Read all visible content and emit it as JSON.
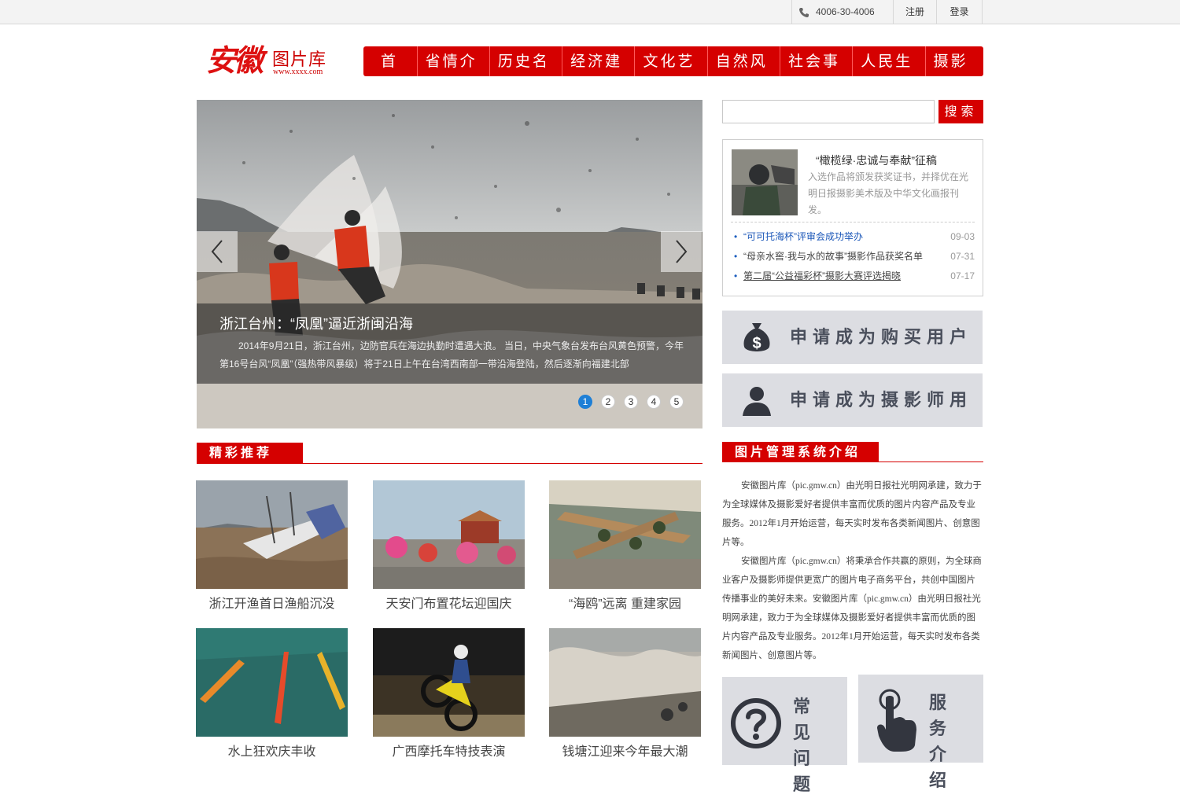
{
  "topbar": {
    "phone": "4006-30-4006",
    "register": "注册",
    "login": "登录"
  },
  "logo": {
    "calligraphy": "安徽",
    "library": "图片库",
    "url": "www.xxxx.com"
  },
  "nav": {
    "items": [
      "首页",
      "省情介绍",
      "历史名人",
      "经济建设",
      "文化艺术",
      "自然风光",
      "社会事业",
      "人民生活",
      "摄影师"
    ]
  },
  "slider": {
    "title": "浙江台州：“凤凰”逼近浙闽沿海",
    "desc": "2014年9月21日，浙江台州，边防官兵在海边执勤时遭遇大浪。 当日，中央气象台发布台风黄色预警，今年第16号台风“凤凰”（强热带风暴级）将于21日上午在台湾西南部一带沿海登陆，然后逐渐向福建北部",
    "dots": [
      "1",
      "2",
      "3",
      "4",
      "5"
    ],
    "active_dot": 1
  },
  "featured": {
    "title": "精彩推荐",
    "items": [
      "浙江开渔首日渔船沉没",
      "天安门布置花坛迎国庆",
      "“海鸥”远离 重建家园",
      "水上狂欢庆丰收",
      "广西摩托车特技表演",
      "钱塘江迎来今年最大潮"
    ]
  },
  "search": {
    "placeholder": "",
    "button": "搜索"
  },
  "news": {
    "headline": "“橄榄绿·忠诚与奉献”征稿",
    "headline_desc": "入选作品将颁发获奖证书，并择优在光明日报摄影美术版及中华文化画报刊发。",
    "items": [
      {
        "title": "“可可托海杯”评审会成功举办",
        "date": "09-03"
      },
      {
        "title": "“母亲水窖·我与水的故事”摄影作品获奖名单",
        "date": "07-31"
      },
      {
        "title": "第二届“公益福彩杯”摄影大赛评选揭晓",
        "date": "07-17"
      }
    ]
  },
  "apply": {
    "buyer": "申请成为购买用户",
    "photographer": "申请成为摄影师用户"
  },
  "intro": {
    "title": "图片管理系统介绍",
    "p1": "安徽图片库（pic.gmw.cn）由光明日报社光明网承建，致力于为全球媒体及摄影爱好者提供丰富而优质的图片内容产品及专业服务。2012年1月开始运营，每天实时发布各类新闻图片、创意图片等。",
    "p2": "安徽图片库（pic.gmw.cn）将秉承合作共赢的原则，为全球商业客户及摄影师提供更宽广的图片电子商务平台，共创中国图片传播事业的美好未来。安徽图片库（pic.gmw.cn）由光明日报社光明网承建，致力于为全球媒体及摄影爱好者提供丰富而优质的图片内容产品及专业服务。2012年1月开始运营，每天实时发布各类新闻图片、创意图片等。"
  },
  "bottom": {
    "faq": "常见问题",
    "service": "服务介绍"
  }
}
